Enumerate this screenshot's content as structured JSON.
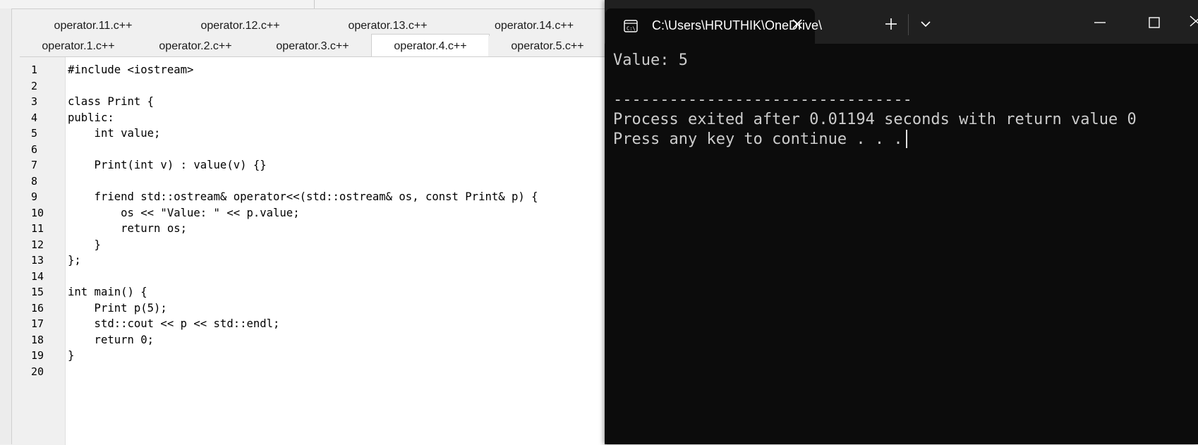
{
  "ide": {
    "tabs_top": [
      "operator.11.c++",
      "operator.12.c++",
      "operator.13.c++",
      "operator.14.c++"
    ],
    "tabs_bottom": [
      "operator.1.c++",
      "operator.2.c++",
      "operator.3.c++",
      "operator.4.c++",
      "operator.5.c++"
    ],
    "active_tab": "operator.4.c++",
    "line_numbers": [
      "1",
      "2",
      "3",
      "4",
      "5",
      "6",
      "7",
      "8",
      "9",
      "10",
      "11",
      "12",
      "13",
      "14",
      "15",
      "16",
      "17",
      "18",
      "19",
      "20"
    ],
    "code_lines": [
      "#include <iostream>",
      "",
      "class Print {",
      "public:",
      "    int value;",
      "",
      "    Print(int v) : value(v) {}",
      "",
      "    friend std::ostream& operator<<(std::ostream& os, const Print& p) {",
      "        os << \"Value: \" << p.value;",
      "        return os;",
      "    }",
      "};",
      "",
      "int main() {",
      "    Print p(5);",
      "    std::cout << p << std::endl;",
      "    return 0;",
      "}",
      ""
    ]
  },
  "terminal": {
    "tab_title": "C:\\Users\\HRUTHIK\\OneDrive\\",
    "tab_icon": "console-icon",
    "output_lines": [
      "Value: 5",
      "",
      "--------------------------------",
      "Process exited after 0.01194 seconds with return value 0",
      "Press any key to continue . . ."
    ],
    "colors": {
      "background": "#0c0c0c",
      "titlebar": "#202020",
      "text": "#cccccc"
    }
  }
}
